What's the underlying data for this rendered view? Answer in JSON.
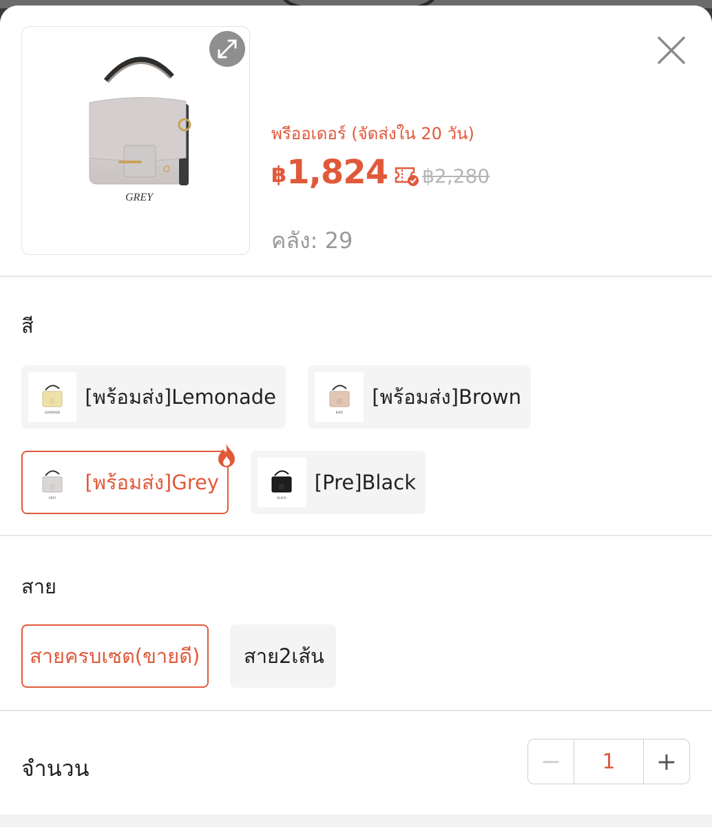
{
  "product": {
    "image_caption": "GREY",
    "preorder_text": "พรีออเดอร์ (จัดส่งใน 20 วัน)",
    "currency": "฿",
    "price": "1,824",
    "original_price": "฿2,280",
    "stock_label": "คลัง: 29"
  },
  "color_section": {
    "title": "สี",
    "options": [
      {
        "label": "[พร้อมส่ง]Lemonade",
        "caption": "LEMONADE",
        "selected": false,
        "swatch": "#efe2a8"
      },
      {
        "label": "[พร้อมส่ง]Brown",
        "caption": "BABY",
        "selected": false,
        "swatch": "#e3c7b6"
      },
      {
        "label": "[พร้อมส่ง]Grey",
        "caption": "GREY",
        "selected": true,
        "swatch": "#dcd7d7"
      },
      {
        "label": "[Pre]Black",
        "caption": "BLACK",
        "selected": false,
        "swatch": "#1e1e1e"
      }
    ]
  },
  "strap_section": {
    "title": "สาย",
    "options": [
      {
        "label": "สายครบเซต(ขายดี)",
        "selected": true
      },
      {
        "label": "สาย2เส้น",
        "selected": false
      }
    ]
  },
  "quantity": {
    "label": "จำนวน",
    "value": "1",
    "minus": "−",
    "plus": "+"
  },
  "colors": {
    "accent": "#e0593a",
    "muted": "#999999"
  },
  "icons": {
    "close": "close-icon",
    "expand": "expand-icon",
    "voucher": "voucher-icon",
    "hot": "flame-icon"
  }
}
